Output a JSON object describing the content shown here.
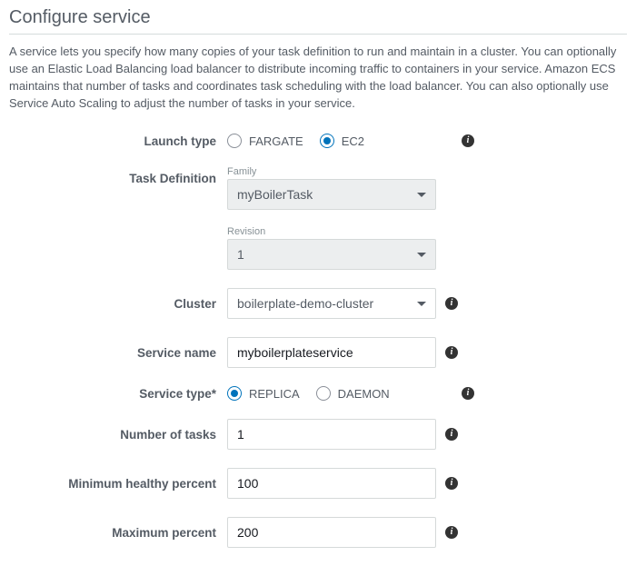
{
  "header": {
    "title": "Configure service",
    "description": "A service lets you specify how many copies of your task definition to run and maintain in a cluster. You can optionally use an Elastic Load Balancing load balancer to distribute incoming traffic to containers in your service. Amazon ECS maintains that number of tasks and coordinates task scheduling with the load balancer. You can also optionally use Service Auto Scaling to adjust the number of tasks in your service."
  },
  "form": {
    "launch_type": {
      "label": "Launch type",
      "options": {
        "fargate": "FARGATE",
        "ec2": "EC2"
      },
      "selected": "ec2"
    },
    "task_definition": {
      "label": "Task Definition",
      "family_label": "Family",
      "family_value": "myBoilerTask",
      "revision_label": "Revision",
      "revision_value": "1"
    },
    "cluster": {
      "label": "Cluster",
      "value": "boilerplate-demo-cluster"
    },
    "service_name": {
      "label": "Service name",
      "value": "myboilerplateservice"
    },
    "service_type": {
      "label": "Service type*",
      "options": {
        "replica": "REPLICA",
        "daemon": "DAEMON"
      },
      "selected": "replica"
    },
    "number_of_tasks": {
      "label": "Number of tasks",
      "value": "1"
    },
    "min_healthy_percent": {
      "label": "Minimum healthy percent",
      "value": "100"
    },
    "max_percent": {
      "label": "Maximum percent",
      "value": "200"
    }
  },
  "icons": {
    "info": "i"
  }
}
